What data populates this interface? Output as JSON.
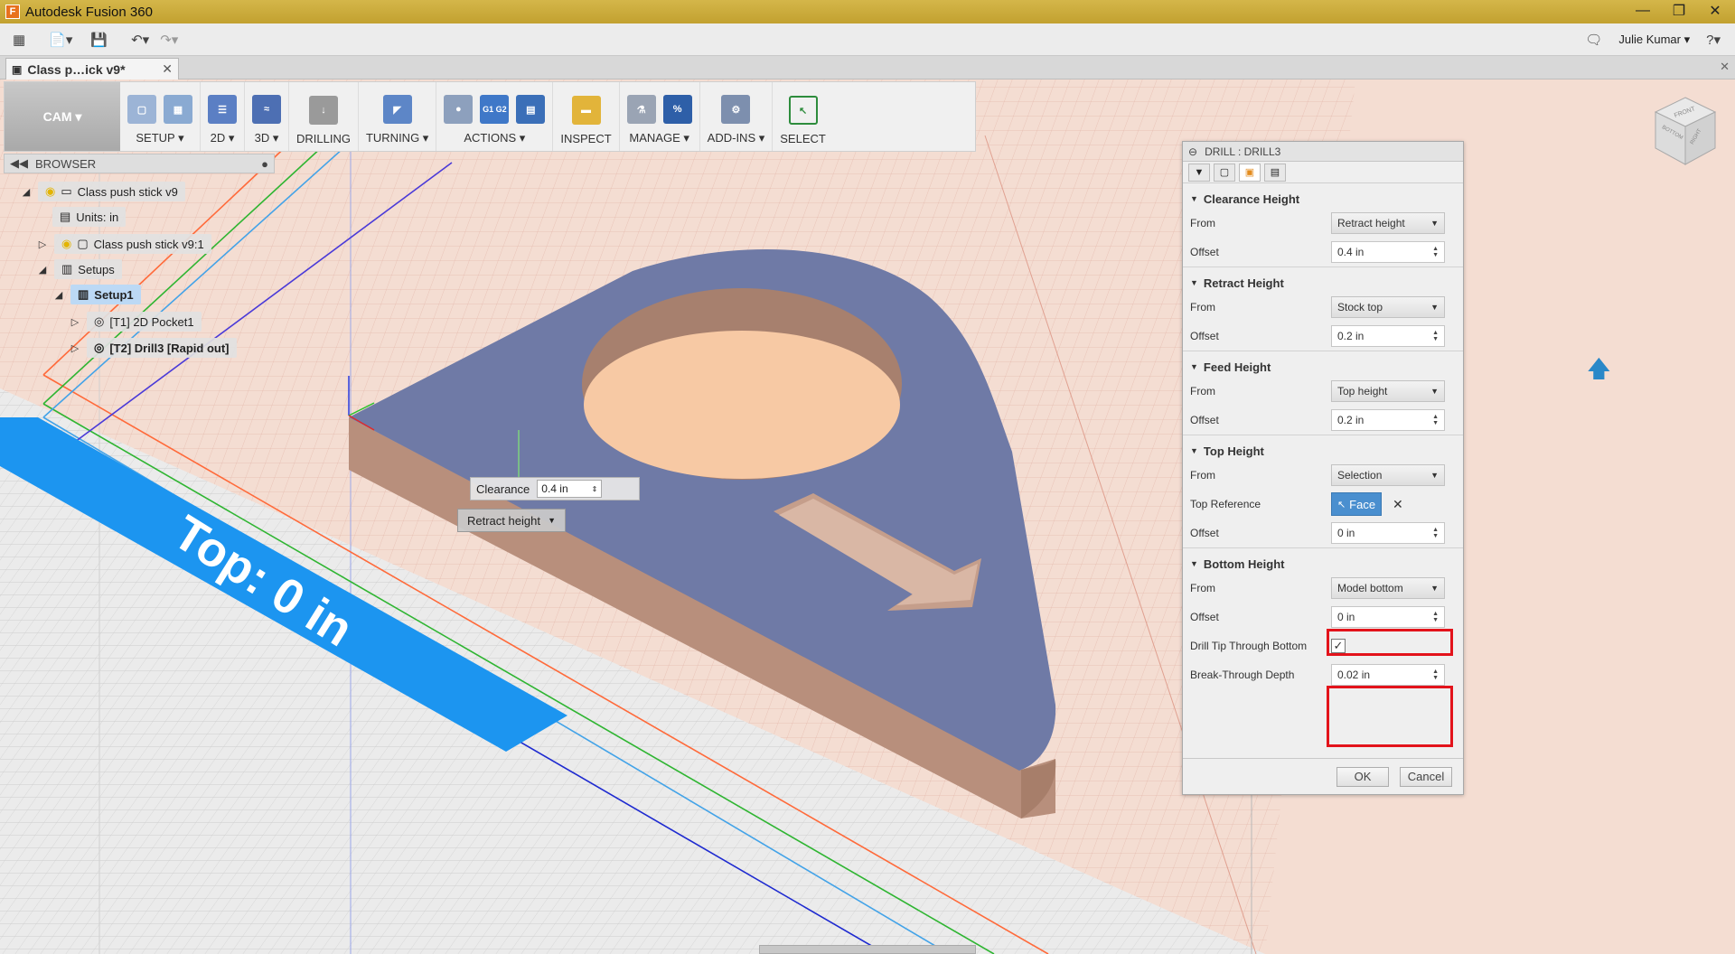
{
  "window": {
    "title": "Autodesk Fusion 360",
    "user": "Julie Kumar",
    "help": "?"
  },
  "document_tab": {
    "label": "Class p…ick v9*"
  },
  "ribbon": {
    "workspace": "CAM ▾",
    "groups": [
      {
        "label": "SETUP ▾"
      },
      {
        "label": "2D ▾"
      },
      {
        "label": "3D ▾"
      },
      {
        "label": "DRILLING"
      },
      {
        "label": "TURNING ▾"
      },
      {
        "label": "ACTIONS ▾"
      },
      {
        "label": "INSPECT"
      },
      {
        "label": "MANAGE ▾"
      },
      {
        "label": "ADD-INS ▾"
      },
      {
        "label": "SELECT"
      }
    ],
    "actions_icon_text": "G1 G2",
    "manage_icon_text": "%"
  },
  "browser": {
    "title": "BROWSER",
    "items": [
      {
        "label": "Class push stick v9"
      },
      {
        "label": "Units: in"
      },
      {
        "label": "Class push stick v9:1"
      },
      {
        "label": "Setups"
      },
      {
        "label": "Setup1"
      },
      {
        "label": "[T1] 2D Pocket1"
      },
      {
        "label": "[T2] Drill3 [Rapid out]"
      }
    ]
  },
  "canvas": {
    "banner_text": "Top: 0 in",
    "manipulator": {
      "label": "Clearance",
      "value": "0.4 in",
      "dropdown": "Retract height"
    }
  },
  "dialog": {
    "title": "DRILL : DRILL3",
    "sections": {
      "clearance": {
        "title": "Clearance Height",
        "from_label": "From",
        "from_value": "Retract height",
        "offset_label": "Offset",
        "offset_value": "0.4 in"
      },
      "retract": {
        "title": "Retract Height",
        "from_label": "From",
        "from_value": "Stock top",
        "offset_label": "Offset",
        "offset_value": "0.2 in"
      },
      "feed": {
        "title": "Feed Height",
        "from_label": "From",
        "from_value": "Top height",
        "offset_label": "Offset",
        "offset_value": "0.2 in"
      },
      "top": {
        "title": "Top Height",
        "from_label": "From",
        "from_value": "Selection",
        "ref_label": "Top Reference",
        "ref_value": "Face",
        "offset_label": "Offset",
        "offset_value": "0 in"
      },
      "bottom": {
        "title": "Bottom Height",
        "from_label": "From",
        "from_value": "Model bottom",
        "offset_label": "Offset",
        "offset_value": "0 in",
        "tip_label": "Drill Tip Through Bottom",
        "tip_checked": true,
        "break_label": "Break-Through Depth",
        "break_value": "0.02 in"
      }
    },
    "ok": "OK",
    "cancel": "Cancel"
  },
  "viewcube": {
    "front": "FRONT",
    "right": "RIGHT",
    "bottom": "BOTTOM"
  },
  "colors": {
    "titlebar": "#c9ab3c",
    "background": "#f2d8cc",
    "part_top": "#6f7aa6",
    "part_side": "#b88f7c",
    "banner": "#1c95f0",
    "highlight": "#e3131b",
    "face_button": "#4a8fcf"
  }
}
